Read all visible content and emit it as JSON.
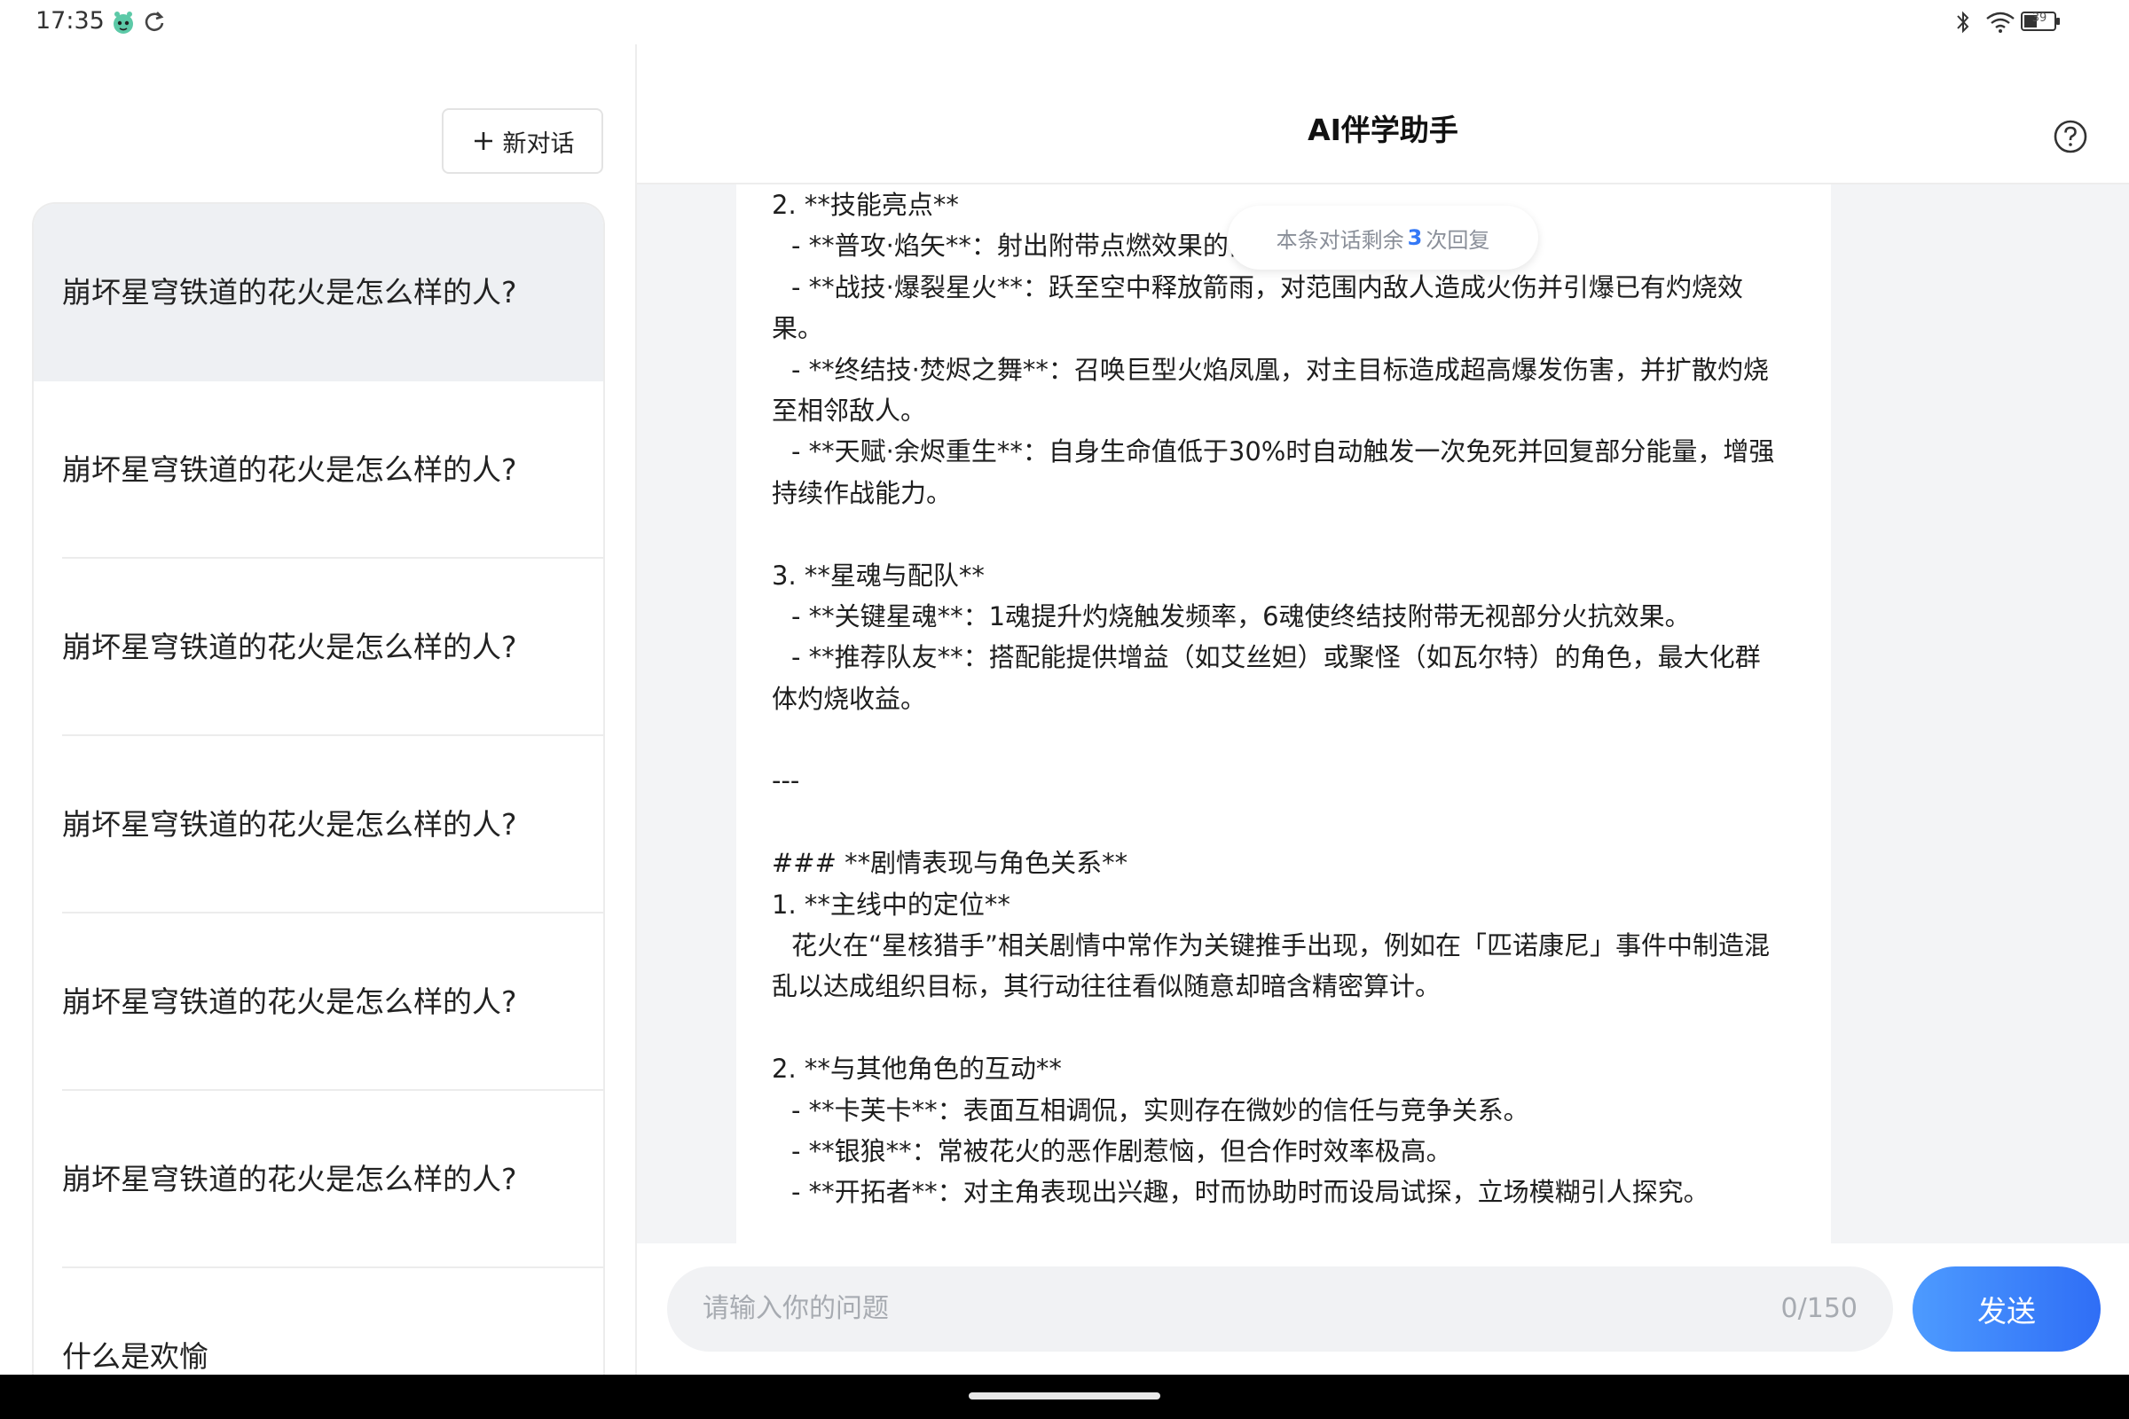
{
  "status_bar": {
    "time": "17:35",
    "battery": "39",
    "icons": [
      "mascot-icon",
      "refresh-icon",
      "bluetooth-icon",
      "wifi-icon",
      "battery-icon"
    ]
  },
  "sidebar": {
    "new_chat_label": "新对话",
    "items": [
      {
        "label": "崩坏星穹铁道的花火是怎么样的人?"
      },
      {
        "label": "崩坏星穹铁道的花火是怎么样的人?"
      },
      {
        "label": "崩坏星穹铁道的花火是怎么样的人?"
      },
      {
        "label": "崩坏星穹铁道的花火是怎么样的人?"
      },
      {
        "label": "崩坏星穹铁道的花火是怎么样的人?"
      },
      {
        "label": "崩坏星穹铁道的花火是怎么样的人?"
      },
      {
        "label": "什么是欢愉"
      }
    ]
  },
  "header": {
    "title": "AI伴学助手"
  },
  "remaining_notice": {
    "prefix": "本条对话剩余",
    "count": "3",
    "suffix": "次回复"
  },
  "message": {
    "lines": [
      "2. **技能亮点**",
      "- **普攻·焰矢**：射出附带点燃效果的箭矢，叠加灼烧层数。",
      "- **战技·爆裂星火**：跃至空中释放箭雨，对范围内敌人造成火伤并引爆已有灼烧效",
      "果。",
      "- **终结技·焚烬之舞**：召唤巨型火焰凤凰，对主目标造成超高爆发伤害，并扩散灼烧",
      "至相邻敌人。",
      "- **天赋·余烬重生**：自身生命值低于30%时自动触发一次免死并回复部分能量，增强",
      "持续作战能力。",
      "",
      "3. **星魂与配队**",
      "- **关键星魂**：1魂提升灼烧触发频率，6魂使终结技附带无视部分火抗效果。",
      "- **推荐队友**：搭配能提供增益（如艾丝妲）或聚怪（如瓦尔特）的角色，最大化群",
      "体灼烧收益。",
      "",
      "---",
      "",
      "### **剧情表现与角色关系**",
      "1. **主线中的定位**",
      "花火在“星核猎手”相关剧情中常作为关键推手出现，例如在「匹诺康尼」事件中制造混",
      "乱以达成组织目标，其行动往往看似随意却暗含精密算计。",
      "",
      "2. **与其他角色的互动**",
      "- **卡芙卡**：表面互相调侃，实则存在微妙的信任与竞争关系。",
      "- **银狼**：常被花火的恶作剧惹恼，但合作时效率极高。",
      "- **开拓者**：对主角表现出兴趣，时而协助时而设局试探，立场模糊引人探究。"
    ],
    "indented": [
      1,
      2,
      4,
      6,
      10,
      11,
      18,
      22,
      23,
      24
    ]
  },
  "input": {
    "placeholder": "请输入你的问题",
    "count": "0/150",
    "send_label": "发送"
  },
  "colors": {
    "accent": "#3478f6",
    "send_gradient_start": "#4d9bff",
    "send_gradient_end": "#2f6ef6",
    "active_item_bg": "#eef0f3",
    "chat_bg": "#f3f4f6"
  }
}
